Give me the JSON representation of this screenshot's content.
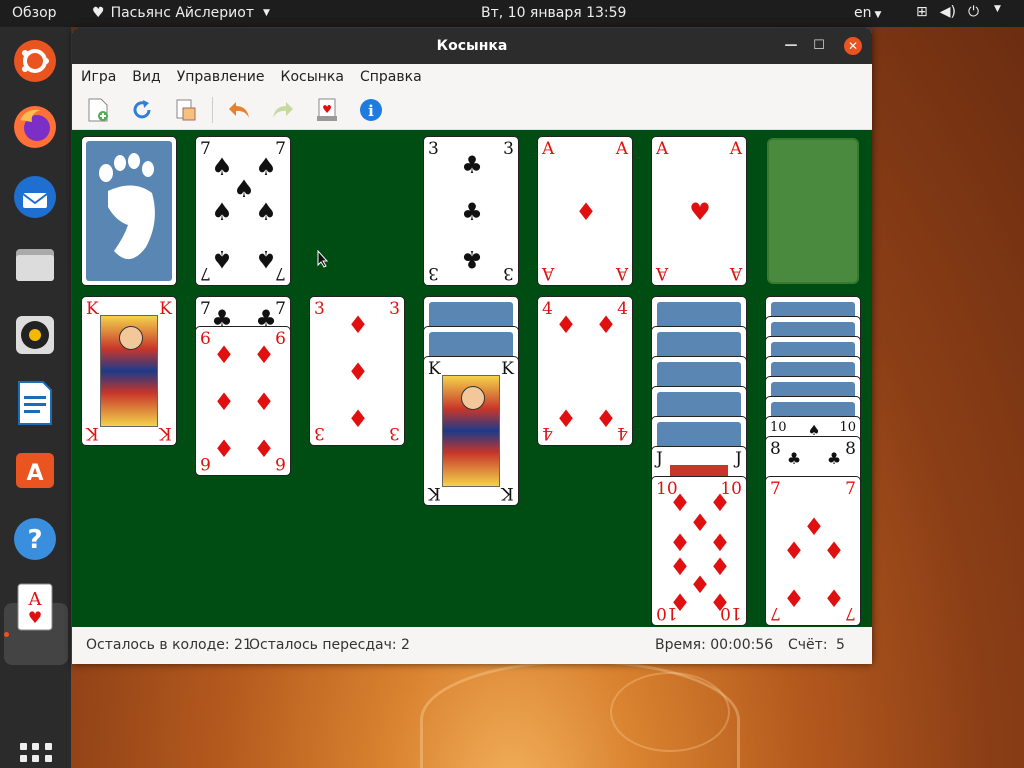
{
  "topbar": {
    "activities": "Обзор",
    "app_name": "Пасьянс Айслериот",
    "clock": "Вт, 10 января  13:59",
    "lang": "en"
  },
  "window": {
    "title": "Косынка",
    "menu": [
      "Игра",
      "Вид",
      "Управление",
      "Косынка",
      "Справка"
    ]
  },
  "toolbar": {
    "buttons": [
      "new-game-icon",
      "restart-icon",
      "hint-icon",
      "undo-icon",
      "redo-icon",
      "deal-icon",
      "info-icon"
    ]
  },
  "status": {
    "deck_left": "Осталось в колоде: 21",
    "redeals_left": "Осталось пересдач: 2",
    "time": "Время: 00:00:56",
    "score_label": "Счёт:",
    "score": "5"
  },
  "cards": {
    "waste": "7",
    "foundation1": "3",
    "foundation2": "A",
    "foundation3": "A",
    "t1": "K",
    "t2a": "7",
    "t2b": "6",
    "t3": "3",
    "t4": "K",
    "t5": "4",
    "t6a": "J",
    "t6b": "10",
    "t7a": "10",
    "t7b": "8",
    "t7c": "7"
  },
  "colors": {
    "felt": "#004d13",
    "card_back": "#5a86b3",
    "accent": "#e95420"
  }
}
